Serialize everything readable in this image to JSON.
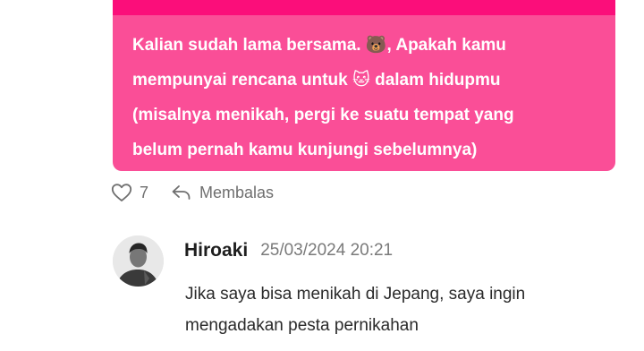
{
  "highlight_comment": {
    "text": "Kalian sudah lama bersama. 🐻, Apakah kamu\nmempunyai rencana untuk 🐱 dalam hidupmu\n(misalnya menikah, pergi ke suatu tempat yang\nbelum pernah kamu kunjungi sebelumnya)",
    "like_count": "7",
    "reply_label": "Membalas"
  },
  "reply_comment": {
    "author": "Hiroaki",
    "timestamp": "25/03/2024 20:21",
    "text": "Jika saya bisa menikah di Jepang, saya ingin\nmengadakan pesta pernikahan"
  },
  "colors": {
    "bubble": "#fa4e97",
    "bubble_top": "#fb0e7a",
    "text_muted": "#6f6f6f"
  },
  "icons": {
    "like": "heart-outline-icon",
    "reply": "reply-arrow-icon"
  }
}
